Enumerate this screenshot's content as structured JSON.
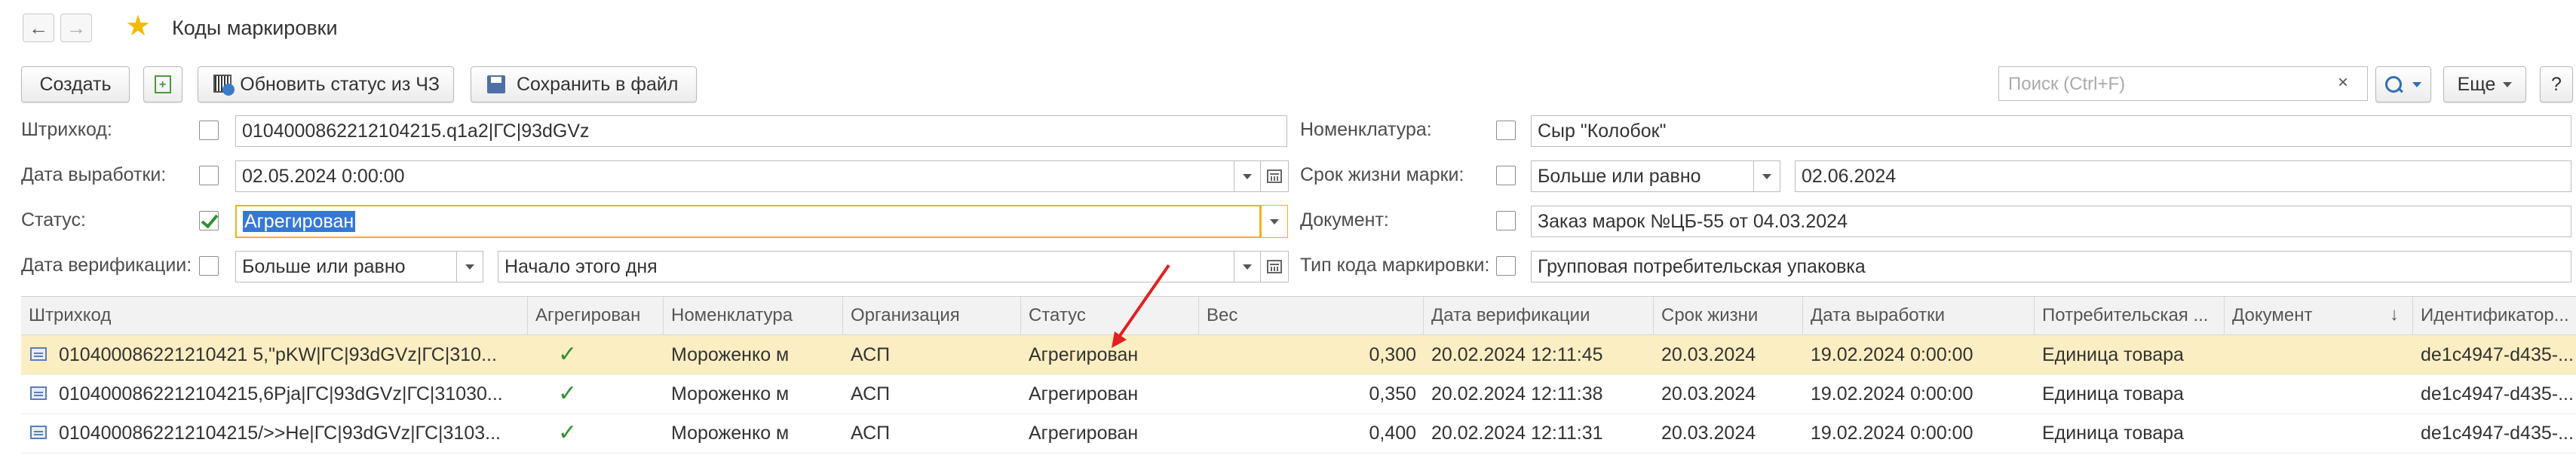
{
  "header": {
    "title": "Коды маркировки",
    "back_glyph": "🡐",
    "forward_glyph": "🡒"
  },
  "toolbar": {
    "create_label": "Создать",
    "update_status_label": "Обновить статус из ЧЗ",
    "save_file_label": "Сохранить в файл",
    "search_placeholder": "Поиск (Ctrl+F)",
    "search_clear": "×",
    "more_label": "Еще",
    "help_label": "?"
  },
  "filters": {
    "barcode": {
      "label": "Штрихкод:",
      "checked": false,
      "value": "0104000862212104215.q1a2|ГС|93dGVz"
    },
    "production_date": {
      "label": "Дата выработки:",
      "checked": false,
      "value": "02.05.2024  0:00:00"
    },
    "status": {
      "label": "Статус:",
      "checked": true,
      "value": "Агрегирован"
    },
    "verification_date": {
      "label": "Дата верификации:",
      "checked": false,
      "comparison": "Больше или равно",
      "value": "Начало этого дня"
    },
    "nomenclature": {
      "label": "Номенклатура:",
      "checked": false,
      "value": "Сыр \"Колобок\""
    },
    "shelf_life": {
      "label": "Срок жизни марки:",
      "checked": false,
      "comparison": "Больше или равно",
      "value": "02.06.2024"
    },
    "document": {
      "label": "Документ:",
      "checked": false,
      "value": "Заказ марок №ЦБ-55 от 04.03.2024"
    },
    "code_type": {
      "label": "Тип кода маркировки:",
      "checked": false,
      "value": "Групповая потребительская упаковка"
    }
  },
  "table": {
    "columns": [
      "Штрихкод",
      "Агрегирован",
      "Номенклатура",
      "Организация",
      "Статус",
      "Вес",
      "Дата верификации",
      "Срок жизни",
      "Дата выработки",
      "Потребительская ...",
      "Документ",
      "Идентификатор..."
    ],
    "sort_indicator": "↓",
    "rows": [
      {
        "barcode": "010400086221210421 5,\"pKW|ГС|93dGVz|ГС|310...",
        "aggregated": "✓",
        "nomenclature": "Мороженко м",
        "organization": "АСП",
        "status": "Агрегирован",
        "weight": "0,300",
        "verified": "20.02.2024 12:11:45",
        "shelf": "20.03.2024",
        "produced": "19.02.2024 0:00:00",
        "consumer": "Единица товара",
        "document": "",
        "id": "de1c4947-d435-..."
      },
      {
        "barcode": "0104000862212104215,6Pja|ГС|93dGVz|ГС|31030...",
        "aggregated": "✓",
        "nomenclature": "Мороженко м",
        "organization": "АСП",
        "status": "Агрегирован",
        "weight": "0,350",
        "verified": "20.02.2024 12:11:38",
        "shelf": "20.03.2024",
        "produced": "19.02.2024 0:00:00",
        "consumer": "Единица товара",
        "document": "",
        "id": "de1c4947-d435-..."
      },
      {
        "barcode": "0104000862212104215/>>He|ГС|93dGVz|ГС|3103...",
        "aggregated": "✓",
        "nomenclature": "Мороженко м",
        "organization": "АСП",
        "status": "Агрегирован",
        "weight": "0,400",
        "verified": "20.02.2024 12:11:31",
        "shelf": "20.03.2024",
        "produced": "19.02.2024 0:00:00",
        "consumer": "Единица товара",
        "document": "",
        "id": "de1c4947-d435-..."
      }
    ]
  },
  "colors": {
    "accent_star": "#f5b800",
    "selected_row": "#fbeec2",
    "focus_border": "#f2b01e",
    "selection_blue": "#3778d6",
    "annotation_arrow": "#e32020"
  }
}
